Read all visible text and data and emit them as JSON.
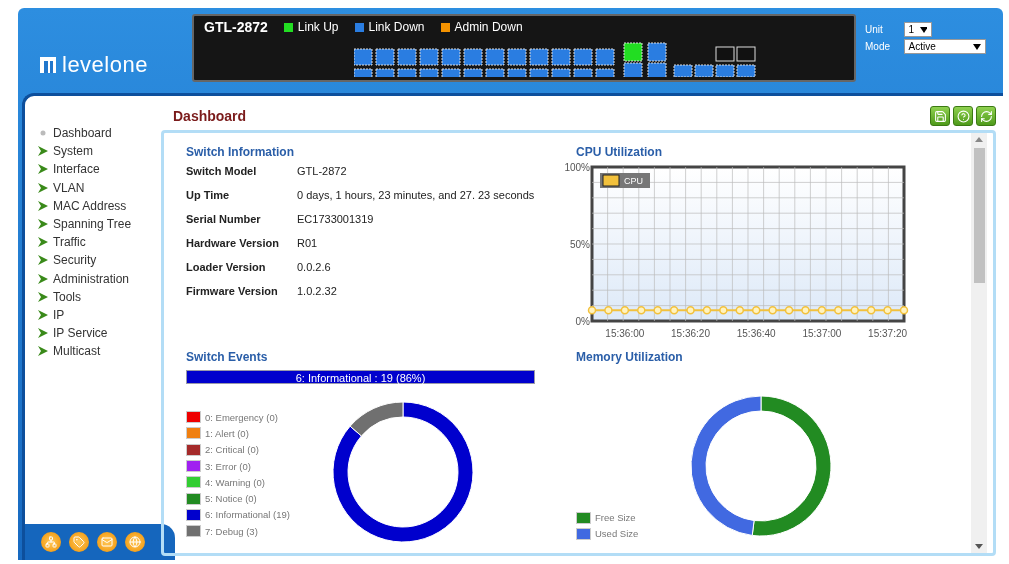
{
  "header": {
    "logo": "levelone",
    "model": "GTL-2872",
    "legend": [
      {
        "label": "Link Up",
        "color": "#22dd22"
      },
      {
        "label": "Link Down",
        "color": "#2a7de1"
      },
      {
        "label": "Admin Down",
        "color": "#f39200"
      }
    ],
    "ports": [
      {
        "kind": "copper",
        "up": false
      },
      {
        "kind": "copper",
        "up": false
      },
      {
        "kind": "copper",
        "up": false
      },
      {
        "kind": "copper",
        "up": false
      },
      {
        "kind": "copper",
        "up": false
      },
      {
        "kind": "copper",
        "up": false
      },
      {
        "kind": "copper",
        "up": false
      },
      {
        "kind": "copper",
        "up": false
      },
      {
        "kind": "copper",
        "up": false
      },
      {
        "kind": "copper",
        "up": false
      },
      {
        "kind": "copper",
        "up": false
      },
      {
        "kind": "copper",
        "up": false
      },
      {
        "kind": "copper",
        "up": false
      },
      {
        "kind": "copper",
        "up": false
      },
      {
        "kind": "copper",
        "up": false
      },
      {
        "kind": "copper",
        "up": false
      },
      {
        "kind": "copper",
        "up": false
      },
      {
        "kind": "copper",
        "up": false
      },
      {
        "kind": "copper",
        "up": false
      },
      {
        "kind": "copper",
        "up": false
      },
      {
        "kind": "copper",
        "up": false
      },
      {
        "kind": "copper",
        "up": false
      },
      {
        "kind": "copper",
        "up": false
      },
      {
        "kind": "copper",
        "up": false
      },
      {
        "kind": "combo",
        "up": true
      },
      {
        "kind": "combo",
        "up": false
      },
      {
        "kind": "combo",
        "up": false
      },
      {
        "kind": "combo",
        "up": false
      },
      {
        "kind": "sfp",
        "up": false
      },
      {
        "kind": "sfp",
        "up": false
      },
      {
        "kind": "sfp",
        "up": false
      },
      {
        "kind": "sfp",
        "up": false
      },
      {
        "kind": "mgmt",
        "up": false
      },
      {
        "kind": "mgmt",
        "up": false
      }
    ],
    "unit": {
      "label": "Unit",
      "value": "1"
    },
    "mode": {
      "label": "Mode",
      "value": "Active"
    }
  },
  "sidebar": {
    "items": [
      {
        "label": "Dashboard",
        "kind": "page"
      },
      {
        "label": "System",
        "kind": "folder"
      },
      {
        "label": "Interface",
        "kind": "folder"
      },
      {
        "label": "VLAN",
        "kind": "folder"
      },
      {
        "label": "MAC Address",
        "kind": "folder"
      },
      {
        "label": "Spanning Tree",
        "kind": "folder"
      },
      {
        "label": "Traffic",
        "kind": "folder"
      },
      {
        "label": "Security",
        "kind": "folder"
      },
      {
        "label": "Administration",
        "kind": "folder"
      },
      {
        "label": "Tools",
        "kind": "folder"
      },
      {
        "label": "IP",
        "kind": "folder"
      },
      {
        "label": "IP Service",
        "kind": "folder"
      },
      {
        "label": "Multicast",
        "kind": "folder"
      }
    ]
  },
  "page": {
    "title": "Dashboard"
  },
  "switch_info": {
    "title": "Switch Information",
    "rows": [
      {
        "label": "Switch Model",
        "value": "GTL-2872"
      },
      {
        "label": "Up Time",
        "value": "0 days, 1 hours, 23 minutes, and 27. 23 seconds"
      },
      {
        "label": "Serial Number",
        "value": "EC1733001319"
      },
      {
        "label": "Hardware Version",
        "value": "R01"
      },
      {
        "label": "Loader Version",
        "value": "0.0.2.6"
      },
      {
        "label": "Firmware Version",
        "value": "1.0.2.32"
      }
    ]
  },
  "cpu": {
    "title": "CPU Utilization",
    "chart_data": {
      "type": "line",
      "categories": [
        null,
        null,
        "15:36:00",
        null,
        null,
        null,
        "15:36:20",
        null,
        null,
        null,
        "15:36:40",
        null,
        null,
        null,
        "15:37:00",
        null,
        null,
        null,
        "15:37:20",
        null
      ],
      "ylim": [
        0,
        100
      ],
      "grid": true,
      "yticks": [
        {
          "value": 0,
          "label": "0%"
        },
        {
          "value": 50,
          "label": "50%"
        },
        {
          "value": 100,
          "label": "100%"
        }
      ],
      "series": [
        {
          "name": "CPU",
          "color": "#f2c13c",
          "marker": "circle",
          "values": [
            7,
            7,
            7,
            7,
            7,
            7,
            7,
            7,
            7,
            7,
            7,
            7,
            7,
            7,
            7,
            7,
            7,
            7,
            7,
            7
          ]
        }
      ]
    }
  },
  "events": {
    "title": "Switch Events",
    "summary": "6: Informational : 19 (86%)",
    "legend": [
      {
        "color": "#ee0000"
      },
      {
        "color": "#f07f10"
      },
      {
        "color": "#a52a2a"
      },
      {
        "color": "#a020f0"
      },
      {
        "color": "#32cd32"
      },
      {
        "color": "#228b22"
      },
      {
        "color": "#0000cd"
      },
      {
        "color": "#707070"
      }
    ],
    "chart_data": {
      "type": "donut",
      "categories": [
        "0: Emergency (0)",
        "1: Alert (0)",
        "2: Critical (0)",
        "3: Error (0)",
        "4: Warning (0)",
        "5: Notice (0)",
        "6: Informational (19)",
        "7: Debug (3)"
      ],
      "series": [
        {
          "values": [
            0,
            0,
            0,
            0,
            0,
            0,
            19,
            3
          ]
        }
      ]
    }
  },
  "memory": {
    "title": "Memory Utilization",
    "legend": [
      {
        "label": "Free Size",
        "color": "#228b22"
      },
      {
        "label": "Used Size",
        "color": "#4169e1"
      }
    ]
  }
}
